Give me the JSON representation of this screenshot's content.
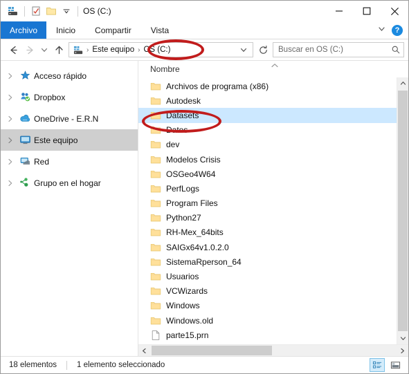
{
  "window": {
    "title": "OS (C:)",
    "quick_access": [
      {
        "name": "computer-icon",
        "label": "Este equipo"
      },
      {
        "name": "properties-icon",
        "label": "Propiedades"
      },
      {
        "name": "new-folder-icon",
        "label": "Nueva carpeta"
      },
      {
        "name": "chevron-down-icon",
        "label": "Personalizar barra de herramientas de acceso rápido"
      }
    ],
    "controls": {
      "minimize": "Minimizar",
      "maximize": "Maximizar",
      "close": "Cerrar"
    }
  },
  "ribbon": {
    "tabs": [
      {
        "label": "Archivo",
        "selected": true
      },
      {
        "label": "Inicio",
        "selected": false
      },
      {
        "label": "Compartir",
        "selected": false
      },
      {
        "label": "Vista",
        "selected": false
      }
    ],
    "expand_icon": "chevron-down-icon",
    "help_label": "?"
  },
  "address": {
    "back_label": "Atrás",
    "forward_label": "Adelante",
    "recent_label": "Ubicaciones recientes",
    "up_label": "Subir un nivel",
    "breadcrumbs": [
      "Este equipo",
      "OS (C:)"
    ],
    "separator": "›",
    "dropdown_icon": "chevron-down-icon",
    "refresh_label": "Actualizar"
  },
  "search": {
    "placeholder": "Buscar en OS (C:)",
    "value": "",
    "icon": "search-icon"
  },
  "navpane": {
    "items": [
      {
        "label": "Acceso rápido",
        "icon": "star-pin-icon",
        "selected": false
      },
      {
        "label": "Dropbox",
        "icon": "dropbox-icon",
        "selected": false
      },
      {
        "label": "OneDrive - E.R.N",
        "icon": "onedrive-cloud-icon",
        "selected": false
      },
      {
        "label": "Este equipo",
        "icon": "computer-monitor-icon",
        "selected": true
      },
      {
        "label": "Red",
        "icon": "network-icon",
        "selected": false
      },
      {
        "label": "Grupo en el hogar",
        "icon": "homegroup-icon",
        "selected": false
      }
    ]
  },
  "filelist": {
    "column_header": "Nombre",
    "sort_direction": "ascending",
    "items": [
      {
        "name": "Archivos de programa (x86)",
        "type": "folder",
        "selected": false
      },
      {
        "name": "Autodesk",
        "type": "folder",
        "selected": false
      },
      {
        "name": "Datasets",
        "type": "folder",
        "selected": true
      },
      {
        "name": "Datos",
        "type": "folder",
        "selected": false
      },
      {
        "name": "dev",
        "type": "folder",
        "selected": false
      },
      {
        "name": "Modelos Crisis",
        "type": "folder",
        "selected": false
      },
      {
        "name": "OSGeo4W64",
        "type": "folder",
        "selected": false
      },
      {
        "name": "PerfLogs",
        "type": "folder",
        "selected": false
      },
      {
        "name": "Program Files",
        "type": "folder",
        "selected": false
      },
      {
        "name": "Python27",
        "type": "folder",
        "selected": false
      },
      {
        "name": "RH-Mex_64bits",
        "type": "folder",
        "selected": false
      },
      {
        "name": "SAIGx64v1.0.2.0",
        "type": "folder",
        "selected": false
      },
      {
        "name": "SistemaRperson_64",
        "type": "folder",
        "selected": false
      },
      {
        "name": "Usuarios",
        "type": "folder",
        "selected": false
      },
      {
        "name": "VCWizards",
        "type": "folder",
        "selected": false
      },
      {
        "name": "Windows",
        "type": "folder",
        "selected": false
      },
      {
        "name": "Windows.old",
        "type": "folder",
        "selected": false
      },
      {
        "name": "parte15.prn",
        "type": "file",
        "selected": false
      }
    ]
  },
  "statusbar": {
    "count": "18 elementos",
    "selection": "1 elemento seleccionado",
    "views": [
      {
        "name": "details-view-button",
        "label": "Detalles",
        "active": true
      },
      {
        "name": "large-icons-view-button",
        "label": "Iconos grandes",
        "active": false
      }
    ]
  },
  "annotations": [
    {
      "name": "annotation-address-os-c",
      "target": "OS (C:)"
    },
    {
      "name": "annotation-datasets-folder",
      "target": "Datasets"
    }
  ],
  "colors": {
    "accent": "#1976d2",
    "selection": "#cce8ff",
    "annotation": "#c11c1c",
    "folder": "#ffdf8a"
  }
}
